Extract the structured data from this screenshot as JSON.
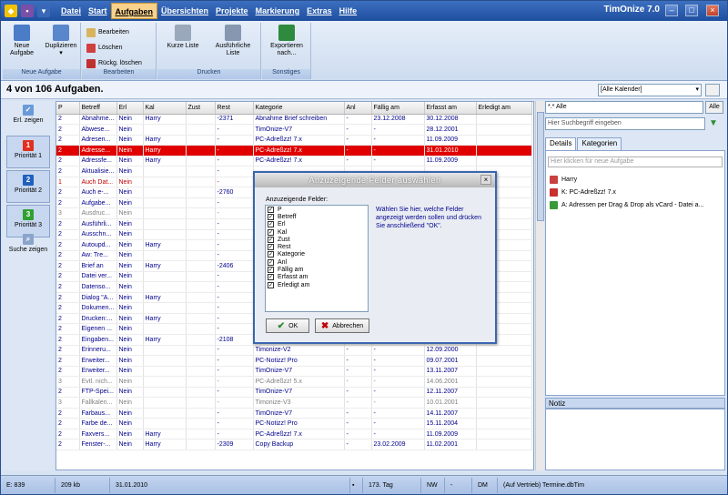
{
  "title_bar": {
    "app_title": "TimOnize 7.0"
  },
  "menu": [
    "Datei",
    "Start",
    "Aufgaben",
    "Übersichten",
    "Projekte",
    "Markierung",
    "Extras",
    "Hilfe"
  ],
  "ribbon": {
    "groups": {
      "neue_aufgabe": "Neue Aufgabe",
      "bearbeiten": "Bearbeiten",
      "drucken": "Drucken",
      "sonstiges": "Sonstiges"
    },
    "buttons": {
      "neue_aufgabe": "Neue Aufgabe",
      "duplizieren": "Duplizieren",
      "bearbeiten": "Bearbeiten",
      "loeschen": "Löschen",
      "rueckg_loeschen": "Rückg. löschen",
      "kurze_liste": "Kurze Liste",
      "ausfuehrliche_liste": "Ausführliche Liste",
      "exportieren": "Exportieren nach..."
    }
  },
  "count_label": "4 von 106 Aufgaben.",
  "calendar_select": "[Alle Kalender]",
  "sidebar": {
    "erl_zeigen": "Erl. zeigen",
    "prio1": "Priorität 1",
    "prio2": "Priorität 2",
    "prio3": "Priorität 3",
    "suche_zeigen": "Suche zeigen"
  },
  "table": {
    "columns": [
      "P",
      "Betreff",
      "Erl",
      "Kal",
      "Zust",
      "Rest",
      "Kategorie",
      "Anl",
      "Fällig am",
      "Erfasst am",
      "Erledigt am"
    ],
    "rows": [
      {
        "cls": "c-blue",
        "cells": [
          "2",
          "Abnahme...",
          "Nein",
          "Harry",
          "",
          "-2371",
          "Abnahme Brief schreiben",
          "-",
          "23.12.2008",
          "30.12.2008",
          ""
        ]
      },
      {
        "cls": "c-blue",
        "cells": [
          "2",
          "Abwese...",
          "Nein",
          "",
          "",
          "-",
          "TimOnize-V7",
          "-",
          "-",
          "28.12.2001",
          ""
        ]
      },
      {
        "cls": "c-blue",
        "cells": [
          "2",
          "Adresen...",
          "Nein",
          "Harry",
          "",
          "-",
          "PC-Adreßzz! 7.x",
          "-",
          "-",
          "11.09.2009",
          ""
        ]
      },
      {
        "cls": "sel",
        "cells": [
          "2",
          "Adresse...",
          "Nein",
          "Harry",
          "",
          "-",
          "PC-Adreßzz! 7.x",
          "-",
          "-",
          "31.01.2010",
          ""
        ]
      },
      {
        "cls": "c-blue",
        "cells": [
          "2",
          "Adressfe...",
          "Nein",
          "Harry",
          "",
          "-",
          "PC-Adreßzz! 7.x",
          "-",
          "-",
          "11.09.2009",
          ""
        ]
      },
      {
        "cls": "c-blue",
        "cells": [
          "2",
          "Aktualisie...",
          "Nein",
          "",
          "",
          "-",
          "",
          "",
          "",
          "",
          ""
        ]
      },
      {
        "cls": "c-red",
        "cells": [
          "1",
          "Auch Dat...",
          "Nein",
          "",
          "",
          "-",
          "",
          "",
          "",
          "",
          ""
        ]
      },
      {
        "cls": "c-blue",
        "cells": [
          "2",
          "Auch e-...",
          "Nein",
          "",
          "",
          "-2760",
          "",
          "",
          "",
          "",
          ""
        ]
      },
      {
        "cls": "c-blue",
        "cells": [
          "2",
          "Aufgabe...",
          "Nein",
          "",
          "",
          "-",
          "",
          "",
          "",
          "",
          ""
        ]
      },
      {
        "cls": "c-gray",
        "cells": [
          "3",
          "Ausdruc...",
          "Nein",
          "",
          "",
          "-",
          "",
          "",
          "",
          "",
          ""
        ]
      },
      {
        "cls": "c-blue",
        "cells": [
          "2",
          "Ausführli...",
          "Nein",
          "",
          "",
          "-",
          "",
          "",
          "",
          "",
          ""
        ]
      },
      {
        "cls": "c-blue",
        "cells": [
          "2",
          "Ausschn...",
          "Nein",
          "",
          "",
          "-",
          "",
          "",
          "",
          "",
          ""
        ]
      },
      {
        "cls": "c-blue",
        "cells": [
          "2",
          "Autoupd...",
          "Nein",
          "Harry",
          "",
          "-",
          "",
          "",
          "",
          "",
          ""
        ]
      },
      {
        "cls": "c-blue",
        "cells": [
          "2",
          "Aw: Tre...",
          "Nein",
          "",
          "",
          "-",
          "",
          "",
          "",
          "",
          ""
        ]
      },
      {
        "cls": "c-blue",
        "cells": [
          "2",
          "Brief an",
          "Nein",
          "Harry",
          "",
          "-2406",
          "",
          "",
          "",
          "",
          ""
        ]
      },
      {
        "cls": "c-blue",
        "cells": [
          "2",
          "Datei ver...",
          "Nein",
          "",
          "",
          "-",
          "",
          "",
          "",
          "",
          ""
        ]
      },
      {
        "cls": "c-blue",
        "cells": [
          "2",
          "Datenso...",
          "Nein",
          "",
          "",
          "-",
          "",
          "",
          "",
          "",
          ""
        ]
      },
      {
        "cls": "c-blue",
        "cells": [
          "2",
          "Dialog \"A...",
          "Nein",
          "Harry",
          "",
          "-",
          "",
          "",
          "",
          "",
          ""
        ]
      },
      {
        "cls": "c-blue",
        "cells": [
          "2",
          "Dokumen...",
          "Nein",
          "",
          "",
          "-",
          "",
          "",
          "",
          "",
          ""
        ]
      },
      {
        "cls": "c-blue",
        "cells": [
          "2",
          "Drucken:...",
          "Nein",
          "Harry",
          "",
          "-",
          "",
          "",
          "",
          "",
          ""
        ]
      },
      {
        "cls": "c-blue",
        "cells": [
          "2",
          "Eigenen ...",
          "Nein",
          "",
          "",
          "-",
          "",
          "",
          "",
          "",
          ""
        ]
      },
      {
        "cls": "c-blue",
        "cells": [
          "2",
          "Eingaben...",
          "Nein",
          "Harry",
          "",
          "-2108",
          "TimOnize-V6",
          "-",
          "12.09.2009",
          "12.09.2009",
          ""
        ]
      },
      {
        "cls": "c-blue",
        "cells": [
          "2",
          "Erinneru...",
          "Nein",
          "",
          "",
          "-",
          "Timonize-V2",
          "-",
          "-",
          "12.09.2000",
          ""
        ]
      },
      {
        "cls": "c-blue",
        "cells": [
          "2",
          "Erweiter...",
          "Nein",
          "",
          "",
          "-",
          "PC-Notizz! Pro",
          "-",
          "-",
          "09.07.2001",
          ""
        ]
      },
      {
        "cls": "c-blue",
        "cells": [
          "2",
          "Erweiter...",
          "Nein",
          "",
          "",
          "-",
          "TimOnize-V7",
          "-",
          "-",
          "13.11.2007",
          ""
        ]
      },
      {
        "cls": "c-gray",
        "cells": [
          "3",
          "Evtl. nich...",
          "Nein",
          "",
          "",
          "-",
          "PC-Adreßzz! 5.x",
          "-",
          "-",
          "14.06.2001",
          ""
        ]
      },
      {
        "cls": "c-blue",
        "cells": [
          "2",
          "FTP-Spei...",
          "Nein",
          "",
          "",
          "-",
          "TimOnize-V7",
          "-",
          "-",
          "12.11.2007",
          ""
        ]
      },
      {
        "cls": "c-gray",
        "cells": [
          "3",
          "Fallkalen...",
          "Nein",
          "",
          "",
          "-",
          "Timonize-V3",
          "-",
          "-",
          "10.01.2001",
          ""
        ]
      },
      {
        "cls": "c-blue",
        "cells": [
          "2",
          "Farbaus...",
          "Nein",
          "",
          "",
          "-",
          "TimOnize-V7",
          "-",
          "-",
          "14.11.2007",
          ""
        ]
      },
      {
        "cls": "c-blue",
        "cells": [
          "2",
          "Farbe de...",
          "Nein",
          "",
          "",
          "-",
          "PC-Notizz! Pro",
          "-",
          "-",
          "15.11.2004",
          ""
        ]
      },
      {
        "cls": "c-blue",
        "cells": [
          "2",
          "Faxvers...",
          "Nein",
          "Harry",
          "",
          "-",
          "PC-Adreßzz! 7.x",
          "-",
          "-",
          "11.09.2009",
          ""
        ]
      },
      {
        "cls": "c-blue",
        "cells": [
          "2",
          "Fenster-...",
          "Nein",
          "Harry",
          "",
          "-2309",
          "Copy Backup",
          "-",
          "23.02.2009",
          "11.02.2001",
          ""
        ]
      }
    ]
  },
  "right_panel": {
    "filter": "*.* Alle",
    "alle_btn": "Alle",
    "search_placeholder": "Hier Suchbegriff eingeben",
    "tabs": [
      "Details",
      "Kategorien"
    ],
    "new_task_placeholder": "Hier klicken für neue Aufgabe",
    "detail_items": [
      "Harry",
      "K: PC-Adreßzz! 7.x",
      "A: Adressen per Drag & Drop als vCard - Datei a..."
    ],
    "notiz_label": "Notiz"
  },
  "status_bar": {
    "entries": "E: 839",
    "size": "209 kb",
    "date": "31.01.2010",
    "day": "173. Tag",
    "nw": "NW",
    "dash": "-",
    "dm": "DM",
    "file": "(Auf Vertrieb) Termine.dbTim"
  },
  "dialog": {
    "title": "Anzuzeigende Felder auswählen",
    "fields_label": "Anzuzeigende Felder:",
    "fields": [
      "P",
      "Betreff",
      "Erl",
      "Kal",
      "Zust",
      "Rest",
      "Kategorie",
      "Anl",
      "Fällig am",
      "Erfasst am",
      "Erledigt am"
    ],
    "help_text": "Wählen Sie hier, welche Felder angezeigt werden sollen und drücken Sie anschließend \"OK\".",
    "ok": "OK",
    "cancel": "Abbrechen"
  },
  "colors": {
    "accent": "#1f4f9f",
    "selected_row": "#e00000",
    "priority1": "#e03020",
    "priority2": "#2060c0",
    "priority3": "#30a030"
  }
}
